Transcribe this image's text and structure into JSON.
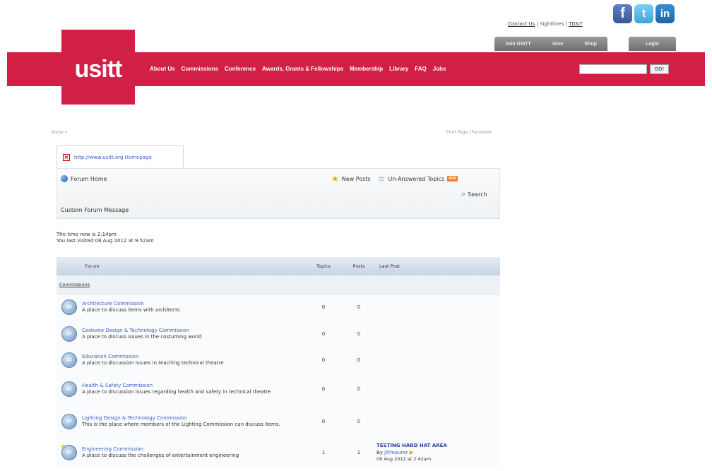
{
  "header": {
    "top_links": {
      "contact": "Contact Us",
      "sep1": " | ",
      "sightlines": "Sightlines",
      "sep2": " | ",
      "tdt": "TD&T"
    },
    "social": {
      "facebook": "f",
      "twitter": "t",
      "linkedin": "in"
    },
    "join_bar": [
      "Join USITT",
      "Give",
      "Shop"
    ],
    "login": "Login",
    "logo": "usitt",
    "nav": [
      "About Us",
      "Commissions",
      "Conference",
      "Awards, Grants & Fellowships",
      "Membership",
      "Library",
      "FAQ",
      "Jobs"
    ],
    "search_value": "",
    "go_label": "GO!"
  },
  "breadcrumb": "Home »",
  "print_links": "Print Page | Facebook",
  "url_tab": "http://www.usitt.org Homepage",
  "forum_bar": {
    "home": "Forum Home",
    "new_posts": "New Posts",
    "unanswered": "Un-Answered Topics",
    "rss": "RSS",
    "search": "Search",
    "custom_message": "Custom Forum Message"
  },
  "time_info": {
    "now": "The time now is 2:14pm",
    "last_visit": "You last visited 08 Aug 2012 at 9:52am"
  },
  "table": {
    "headers": {
      "forum": "Forum",
      "topics": "Topics",
      "posts": "Posts",
      "last_post": "Last Post"
    },
    "category": "Commissions",
    "rows": [
      {
        "name": "Architecture Commission",
        "desc": "A place to discuss items with architects",
        "topics": "0",
        "posts": "0"
      },
      {
        "name": "Costume Design & Technology Commission",
        "desc": "A place to discuss issues in the costuming world",
        "topics": "0",
        "posts": "0"
      },
      {
        "name": "Education Commission",
        "desc": "A place to discussion issues in teaching technical theatre",
        "topics": "0",
        "posts": "0"
      },
      {
        "name": "Health & Safety Commission",
        "desc": "A place to discussion issues regarding health and safety in technical theatre",
        "topics": "0",
        "posts": "0"
      },
      {
        "name": "Lighting Design & Technology Commission",
        "desc": "This is the place where members of the Lighting Commission can discuss items.",
        "topics": "0",
        "posts": "0"
      },
      {
        "name": "Engineering Commission",
        "desc": "A place to discuss the challenges of entertainment engineering",
        "topics": "1",
        "posts": "1",
        "last_post": {
          "title": "TESTING HARD HAT AREA",
          "by": "By ",
          "user": "jillmaurer",
          "date": "09 Aug 2012 at 2:42am"
        }
      }
    ]
  },
  "colors": {
    "brand_red": "#d21f45",
    "link_blue": "#3b5ec8"
  }
}
